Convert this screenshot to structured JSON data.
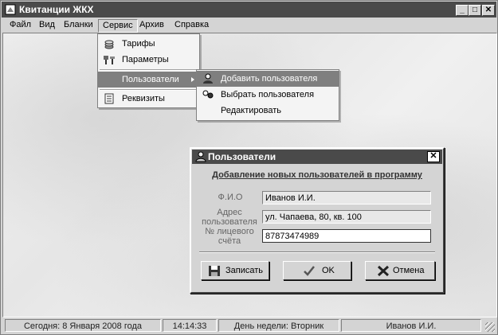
{
  "window": {
    "title": "Квитанции ЖКХ",
    "minimize": "_",
    "maximize": "□",
    "close": "✕"
  },
  "menubar": [
    "Файл",
    "Вид",
    "Бланки",
    "Сервис",
    "Архив",
    "Справка"
  ],
  "service_menu": {
    "items": [
      {
        "label": "Тарифы",
        "icon": "coins-icon"
      },
      {
        "label": "Параметры",
        "icon": "tools-icon"
      },
      {
        "label": "Пользователи",
        "icon": "",
        "submenu": true
      },
      {
        "label": "Реквизиты",
        "icon": "notepad-icon"
      }
    ]
  },
  "users_submenu": {
    "items": [
      {
        "label": "Добавить пользователя",
        "icon": "add-user-icon"
      },
      {
        "label": "Выбрать пользователя",
        "icon": "users-icon"
      },
      {
        "label": "Редактировать",
        "icon": ""
      }
    ]
  },
  "dialog": {
    "title": "Пользователи",
    "close": "✕",
    "heading": "Добавление новых пользователей в программу",
    "fields": [
      {
        "label": "Ф.И.О",
        "value": "Иванов И.И."
      },
      {
        "label": "Адрес пользователя",
        "value": "ул. Чапаева, 80, кв. 100"
      },
      {
        "label": "№ лицевого счёта",
        "value": "87873474989"
      }
    ],
    "buttons": {
      "save": "Записать",
      "ok": "OK",
      "cancel": "Отмена"
    }
  },
  "statusbar": {
    "date": "Сегодня: 8 Января 2008 года",
    "time": "14:14:33",
    "weekday": "День недели: Вторник",
    "user": "Иванов И.И."
  },
  "colors": {
    "titlebar": "#4a4a4a",
    "highlight": "#7f7f7f",
    "face": "#d4d4d4"
  }
}
